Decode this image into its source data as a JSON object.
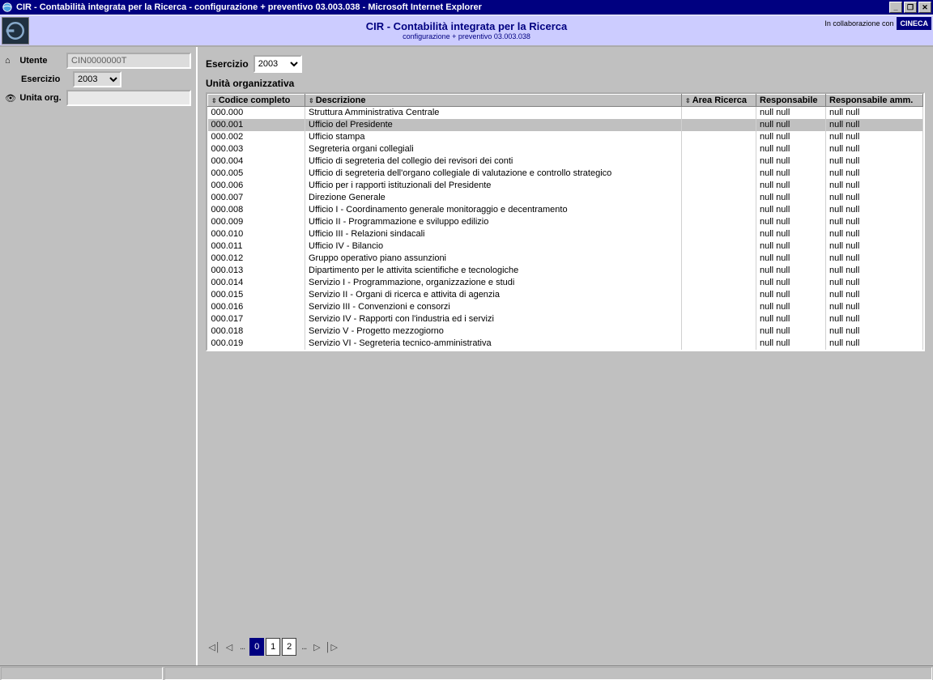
{
  "window": {
    "title": "CIR - Contabilità integrata per la Ricerca - configurazione + preventivo 03.003.038 - Microsoft Internet Explorer"
  },
  "banner": {
    "title": "CIR - Contabilità integrata per la Ricerca",
    "subtitle": "configurazione + preventivo 03.003.038",
    "collab": "In collaborazione con",
    "partner": "CINECA"
  },
  "sidebar": {
    "utente_label": "Utente",
    "utente_value": "CIN0000000T",
    "esercizio_label": "Esercizio",
    "esercizio_value": "2003",
    "unita_label": "Unita org.",
    "unita_value": ""
  },
  "content": {
    "esercizio_label": "Esercizio",
    "esercizio_value": "2003",
    "section_title": "Unità organizzativa",
    "columns": {
      "codice": "Codice completo",
      "descrizione": "Descrizione",
      "area": "Area Ricerca",
      "resp": "Responsabile",
      "resp_amm": "Responsabile amm."
    },
    "rows": [
      {
        "codice": "000.000",
        "descrizione": "Struttura Amministrativa Centrale",
        "area": "",
        "resp": "null null",
        "resp_amm": "null null",
        "selected": false
      },
      {
        "codice": "000.001",
        "descrizione": "Ufficio del Presidente",
        "area": "",
        "resp": "null null",
        "resp_amm": "null null",
        "selected": true
      },
      {
        "codice": "000.002",
        "descrizione": "Ufficio stampa",
        "area": "",
        "resp": "null null",
        "resp_amm": "null null",
        "selected": false
      },
      {
        "codice": "000.003",
        "descrizione": "Segreteria organi collegiali",
        "area": "",
        "resp": "null null",
        "resp_amm": "null null",
        "selected": false
      },
      {
        "codice": "000.004",
        "descrizione": "Ufficio di segreteria del collegio dei revisori dei conti",
        "area": "",
        "resp": "null null",
        "resp_amm": "null null",
        "selected": false
      },
      {
        "codice": "000.005",
        "descrizione": "Ufficio di segreteria dell'organo collegiale di valutazione e controllo strategico",
        "area": "",
        "resp": "null null",
        "resp_amm": "null null",
        "selected": false
      },
      {
        "codice": "000.006",
        "descrizione": "Ufficio per i rapporti istituzionali del Presidente",
        "area": "",
        "resp": "null null",
        "resp_amm": "null null",
        "selected": false
      },
      {
        "codice": "000.007",
        "descrizione": "Direzione Generale",
        "area": "",
        "resp": "null null",
        "resp_amm": "null null",
        "selected": false
      },
      {
        "codice": "000.008",
        "descrizione": "Ufficio I - Coordinamento generale monitoraggio e decentramento",
        "area": "",
        "resp": "null null",
        "resp_amm": "null null",
        "selected": false
      },
      {
        "codice": "000.009",
        "descrizione": "Ufficio II - Programmazione e sviluppo edilizio",
        "area": "",
        "resp": "null null",
        "resp_amm": "null null",
        "selected": false
      },
      {
        "codice": "000.010",
        "descrizione": "Ufficio III - Relazioni sindacali",
        "area": "",
        "resp": "null null",
        "resp_amm": "null null",
        "selected": false
      },
      {
        "codice": "000.011",
        "descrizione": "Ufficio IV - Bilancio",
        "area": "",
        "resp": "null null",
        "resp_amm": "null null",
        "selected": false
      },
      {
        "codice": "000.012",
        "descrizione": "Gruppo operativo piano assunzioni",
        "area": "",
        "resp": "null null",
        "resp_amm": "null null",
        "selected": false
      },
      {
        "codice": "000.013",
        "descrizione": "Dipartimento per le attivita scientifiche e tecnologiche",
        "area": "",
        "resp": "null null",
        "resp_amm": "null null",
        "selected": false
      },
      {
        "codice": "000.014",
        "descrizione": "Servizio I - Programmazione, organizzazione e studi",
        "area": "",
        "resp": "null null",
        "resp_amm": "null null",
        "selected": false
      },
      {
        "codice": "000.015",
        "descrizione": "Servizio II - Organi di ricerca e attivita di agenzia",
        "area": "",
        "resp": "null null",
        "resp_amm": "null null",
        "selected": false
      },
      {
        "codice": "000.016",
        "descrizione": "Servizio III - Convenzioni e consorzi",
        "area": "",
        "resp": "null null",
        "resp_amm": "null null",
        "selected": false
      },
      {
        "codice": "000.017",
        "descrizione": "Servizio IV - Rapporti con l'industria ed i servizi",
        "area": "",
        "resp": "null null",
        "resp_amm": "null null",
        "selected": false
      },
      {
        "codice": "000.018",
        "descrizione": "Servizio V - Progetto mezzogiorno",
        "area": "",
        "resp": "null null",
        "resp_amm": "null null",
        "selected": false
      },
      {
        "codice": "000.019",
        "descrizione": "Servizio VI - Segreteria tecnico-amministrativa",
        "area": "",
        "resp": "null null",
        "resp_amm": "null null",
        "selected": false
      }
    ],
    "pager": {
      "pages": [
        "0",
        "1",
        "2"
      ],
      "active": 0
    }
  }
}
